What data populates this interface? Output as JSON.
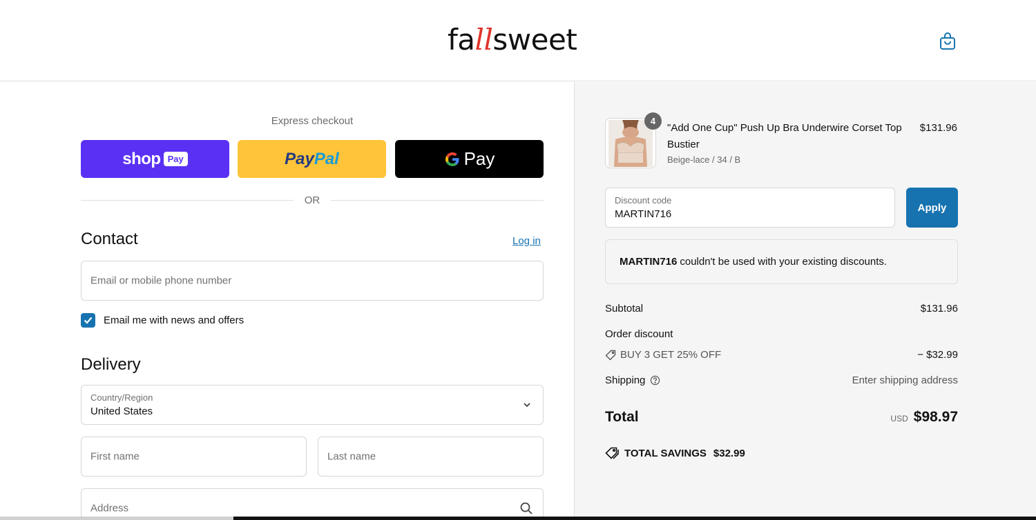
{
  "header": {
    "logo_part1": "fa",
    "logo_part2": "ll",
    "logo_part3": "sweet",
    "cart_icon": "shopping-bag-icon"
  },
  "express": {
    "title": "Express checkout",
    "shop_label": "shop",
    "shop_pay_label": "Pay",
    "paypal_label_1": "Pay",
    "paypal_label_2": "Pal",
    "gpay_g": "G",
    "gpay_label": "Pay",
    "or_text": "OR"
  },
  "contact": {
    "title": "Contact",
    "login_label": "Log in",
    "email_placeholder": "Email or mobile phone number",
    "newsletter_label": "Email me with news and offers",
    "newsletter_checked": true
  },
  "delivery": {
    "title": "Delivery",
    "country_label": "Country/Region",
    "country_value": "United States",
    "first_name_placeholder": "First name",
    "last_name_placeholder": "Last name",
    "address_placeholder": "Address"
  },
  "order": {
    "item": {
      "quantity": "4",
      "name": "\"Add One Cup\" Push Up Bra Underwire Corset Top Bustier",
      "variant": "Beige-lace / 34 / B",
      "price": "$131.96"
    },
    "discount_label": "Discount code",
    "discount_value": "MARTIN716",
    "apply_label": "Apply",
    "notice_code": "MARTIN716",
    "notice_text": "couldn't be used with your existing discounts.",
    "subtotal_label": "Subtotal",
    "subtotal_value": "$131.96",
    "order_discount_label": "Order discount",
    "discount_name": "BUY 3 GET 25% OFF",
    "discount_amount": "− $32.99",
    "shipping_label": "Shipping",
    "shipping_value": "Enter shipping address",
    "total_label": "Total",
    "total_currency": "USD",
    "total_value": "$98.97",
    "savings_label": "TOTAL SAVINGS",
    "savings_value": "$32.99"
  },
  "colors": {
    "accent": "#1773b0",
    "shop_pay": "#5a31f4",
    "paypal": "#ffc439",
    "logo_accent": "#e0342b"
  }
}
